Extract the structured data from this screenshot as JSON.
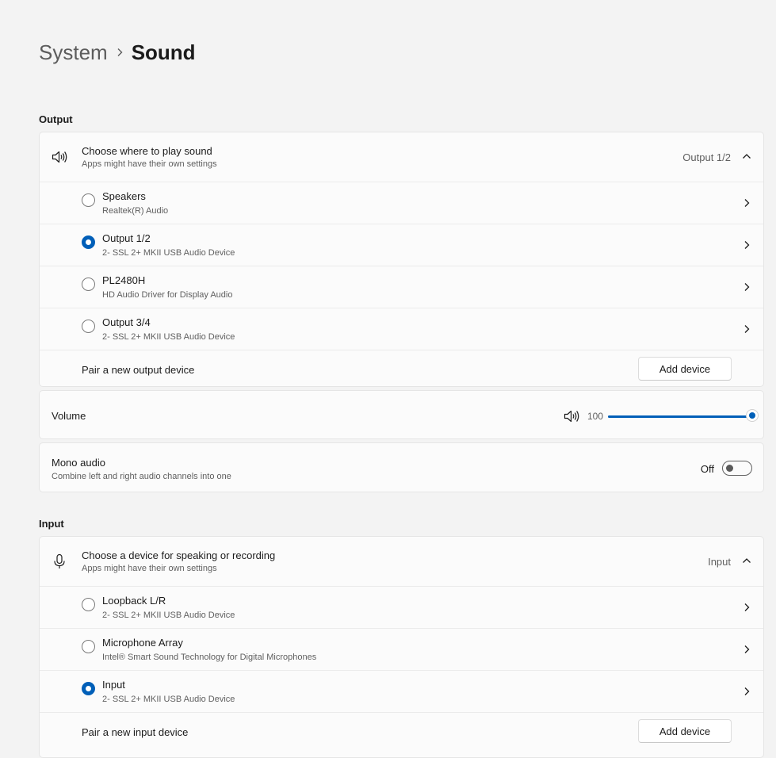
{
  "breadcrumb": {
    "parent": "System",
    "separator": "›",
    "current": "Sound"
  },
  "output": {
    "section_title": "Output",
    "header": {
      "title": "Choose where to play sound",
      "subtitle": "Apps might have their own settings",
      "value": "Output 1/2",
      "icon": "speaker-icon"
    },
    "devices": [
      {
        "name": "Speakers",
        "driver": "Realtek(R) Audio",
        "selected": false
      },
      {
        "name": "Output 1/2",
        "driver": "2- SSL 2+ MKII USB Audio Device",
        "selected": true
      },
      {
        "name": "PL2480H",
        "driver": "HD Audio Driver for Display Audio",
        "selected": false
      },
      {
        "name": "Output 3/4",
        "driver": "2- SSL 2+ MKII USB Audio Device",
        "selected": false
      }
    ],
    "pair_label": "Pair a new output device",
    "add_button": "Add device"
  },
  "volume": {
    "label": "Volume",
    "value": "100",
    "level_percent": 100
  },
  "mono_audio": {
    "title": "Mono audio",
    "subtitle": "Combine left and right audio channels into one",
    "state_label": "Off",
    "enabled": false
  },
  "input": {
    "section_title": "Input",
    "header": {
      "title": "Choose a device for speaking or recording",
      "subtitle": "Apps might have their own settings",
      "value": "Input",
      "icon": "microphone-icon"
    },
    "devices": [
      {
        "name": "Loopback L/R",
        "driver": "2- SSL 2+ MKII USB Audio Device",
        "selected": false
      },
      {
        "name": "Microphone Array",
        "driver": "Intel® Smart Sound Technology for Digital Microphones",
        "selected": false
      },
      {
        "name": "Input",
        "driver": "2- SSL 2+ MKII USB Audio Device",
        "selected": true
      }
    ],
    "pair_label": "Pair a new input device",
    "add_button": "Add device"
  },
  "colors": {
    "accent": "#005fb8",
    "background": "#f3f3f3",
    "card": "#fbfbfb"
  }
}
